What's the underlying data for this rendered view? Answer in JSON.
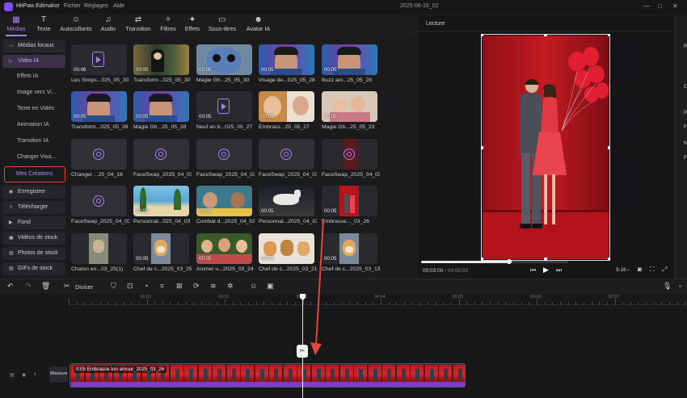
{
  "app": {
    "title": "HitPaw Edimakor",
    "menu": [
      "Fichier",
      "Réglages",
      "Aide"
    ],
    "project": "2025-06-16_02",
    "window_controls": [
      "—",
      "□",
      "✕"
    ]
  },
  "toolbar": [
    {
      "label": "Médias",
      "icon": "media-icon",
      "active": true
    },
    {
      "label": "Texte",
      "icon": "text-icon"
    },
    {
      "label": "Autocollants",
      "icon": "sticker-icon"
    },
    {
      "label": "Audio",
      "icon": "music-icon"
    },
    {
      "label": "Transition",
      "icon": "transition-icon"
    },
    {
      "label": "Filtres",
      "icon": "filter-icon"
    },
    {
      "label": "Effets",
      "icon": "effect-icon"
    },
    {
      "label": "Sous-titres",
      "icon": "subtitle-icon"
    },
    {
      "label": "Avatar IA",
      "icon": "avatar-icon"
    }
  ],
  "sidebar": [
    {
      "label": "Médias locaux",
      "kind": "main"
    },
    {
      "label": "Vidéo IA",
      "kind": "main-selected"
    },
    {
      "label": "Effets IA",
      "kind": "sub"
    },
    {
      "label": "Image vers Vi...",
      "kind": "sub"
    },
    {
      "label": "Texte en Vidéo",
      "kind": "sub"
    },
    {
      "label": "Animation IA",
      "kind": "sub"
    },
    {
      "label": "Transition IA",
      "kind": "sub"
    },
    {
      "label": "Changer Visa...",
      "kind": "sub"
    },
    {
      "label": "Mes Créations",
      "kind": "sub-boxed"
    },
    {
      "label": "Enregistrer",
      "kind": "main"
    },
    {
      "label": "Télécharger",
      "kind": "main"
    },
    {
      "label": "Fond",
      "kind": "main"
    },
    {
      "label": "Vidéos de stock",
      "kind": "main"
    },
    {
      "label": "Photos de stock",
      "kind": "main"
    },
    {
      "label": "GIFs de stock",
      "kind": "main"
    }
  ],
  "media": [
    {
      "name": "Les Simps...025_05_30",
      "dur": "00:06",
      "type": "placeholder"
    },
    {
      "name": "Transform...025_05_30",
      "dur": "00:05",
      "type": "scene"
    },
    {
      "name": "Magie Gh...25_05_30",
      "dur": "00:05",
      "type": "creature"
    },
    {
      "name": "Visage de...025_05_28",
      "dur": "00:05",
      "type": "man"
    },
    {
      "name": "Buzz ani...25_05_28",
      "dur": "00:05",
      "type": "man"
    },
    {
      "name": "Transform...025_05_28",
      "dur": "00:05",
      "type": "man"
    },
    {
      "name": "Magie Gh...25_05_28",
      "dur": "00:05",
      "type": "man"
    },
    {
      "name": "Neuf en b...025_05_27",
      "dur": "00:05",
      "type": "placeholder"
    },
    {
      "name": "Embrass...25_05_27",
      "dur": "00:05",
      "type": "couple"
    },
    {
      "name": "Magie Gh...25_05_23",
      "dur": "00:05",
      "type": "family"
    },
    {
      "name": "Changer ...25_04_16",
      "dur": "",
      "type": "loading"
    },
    {
      "name": "FaceSwap_2025_04_03",
      "dur": "",
      "type": "loading"
    },
    {
      "name": "FaceSwap_2025_04_03",
      "dur": "",
      "type": "loading"
    },
    {
      "name": "FaceSwap_2025_04_03",
      "dur": "",
      "type": "loading"
    },
    {
      "name": "FaceSwap_2025_04_03",
      "dur": "",
      "type": "loading-red"
    },
    {
      "name": "FaceSwap_2025_04_03",
      "dur": "",
      "type": "loading"
    },
    {
      "name": "Personnal...025_04_03",
      "dur": "00:05",
      "type": "beach"
    },
    {
      "name": "Combat d...2025_04_03",
      "dur": "00:05",
      "type": "two"
    },
    {
      "name": "Personnal...2025_04_02",
      "dur": "00:05",
      "type": "horse"
    },
    {
      "name": "Embrasse..._03_26",
      "dur": "00:05",
      "type": "red"
    },
    {
      "name": "Chaton en...03_25(1)",
      "dur": "",
      "type": "cat"
    },
    {
      "name": "Chef de c...2025_03_25",
      "dur": "00:05",
      "type": "dog"
    },
    {
      "name": "Animer u...2025_03_24",
      "dur": "00:05",
      "type": "group"
    },
    {
      "name": "Chef de c...2025_03_21",
      "dur": "00:05",
      "type": "dogs"
    },
    {
      "name": "Chef de c...2025_03_13",
      "dur": "00:05",
      "type": "dog"
    }
  ],
  "preview": {
    "title": "Lecture",
    "time_current": "00:03:00",
    "time_total": "/ 00:05:03",
    "ratio": "9:16",
    "progress": 0.6,
    "right_panel_letters": [
      "R",
      "O",
      "P",
      "F",
      "M",
      "F"
    ]
  },
  "timeline_toolbar": {
    "split_label": "Diviser"
  },
  "timeline": {
    "ruler": [
      "00:01",
      "00:02",
      "00:03",
      "00:04",
      "00:05",
      "00:06",
      "00:07"
    ],
    "track_label": "Miniature",
    "clip_label": "0:05 Embrasse ton amour_2025_03_26"
  },
  "colors": {
    "accent": "#a880ff",
    "clip": "#c0262f",
    "annotation": "#e0473b"
  }
}
